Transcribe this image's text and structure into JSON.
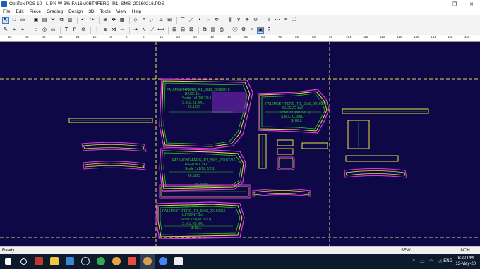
{
  "window": {
    "title": "OptiTex PDS 10 - L-5% W-3% FA16M0BT4FERG_R1_SMS_20160216.PDS",
    "controls": {
      "minimize": "—",
      "maximize": "❐",
      "close": "✕"
    }
  },
  "menu": {
    "items": [
      "File",
      "Edit",
      "Piece",
      "Grading",
      "Design",
      "3D",
      "Tools",
      "View",
      "Help"
    ]
  },
  "ruler": {
    "labels": [
      "-56",
      "-48",
      "-40",
      "-32",
      "-24",
      "-16",
      "-8",
      "0",
      "8",
      "16",
      "24",
      "32",
      "40",
      "48",
      "56",
      "64",
      "72",
      "80",
      "88",
      "96",
      "104",
      "112",
      "120",
      "128",
      "136",
      "144",
      "152",
      "160"
    ]
  },
  "pieces": {
    "back_title": "FA16M0BT4FERG_R1_SMS_20160216",
    "back_name": "BACK 1x1",
    "back_scale": "Scale 1x1(98.1/0.1)",
    "back_size": "S,M,L,XL,XXL",
    "back_dim": "23.1/0.5",
    "sleeve_title": "FA16M0BT4FERG_R1_SMS_20160216",
    "sleeve_name": "SLEEVE 1x2",
    "sleeve_scale": "Scale 1x1(98.1/0.1)",
    "sleeve_size": "S,M,L,XL,XXL",
    "sleeve_shell": "SHELL",
    "rfront_title": "FA16M0BT4FERG_R1_SMS_20160216",
    "rfront_name": "R.FRONT 1x1",
    "rfront_scale": "Scale 1x1(98.1/0.1)",
    "rfront_dim1": "26.5/0.5",
    "rfront_dim2": "29.1/0.5",
    "lfront_dim": "23.1/0.5",
    "lfront_title": "FA16M0BT4FERG_R1_SMS_20160216",
    "lfront_name": "L.FRONT 1x1",
    "lfront_scale": "Scale 1x1(98.1/0.1)",
    "lfront_size": "S,M,L,XL,XXL",
    "lfront_shell": "SHELL"
  },
  "status": {
    "ready": "Ready",
    "mode": "SEW",
    "unit": "INCH"
  },
  "taskbar": {
    "icons": [
      "start-icon",
      "search-icon",
      "task-app-icon",
      "explorer-icon",
      "store-icon",
      "settings-icon",
      "chrome-icon",
      "browser-icon",
      "media-icon",
      "pds-icon",
      "chrome2-icon",
      "video-icon"
    ],
    "lang": "ENG",
    "time": "8:20 PM",
    "date": "13-May-20"
  },
  "colors": {
    "canvas": "#0f0847",
    "dash": "#e8e04a",
    "cut": "#e8e04a",
    "sew": "#28d11c",
    "grade": "#e03adf",
    "label": "#28d11c"
  }
}
